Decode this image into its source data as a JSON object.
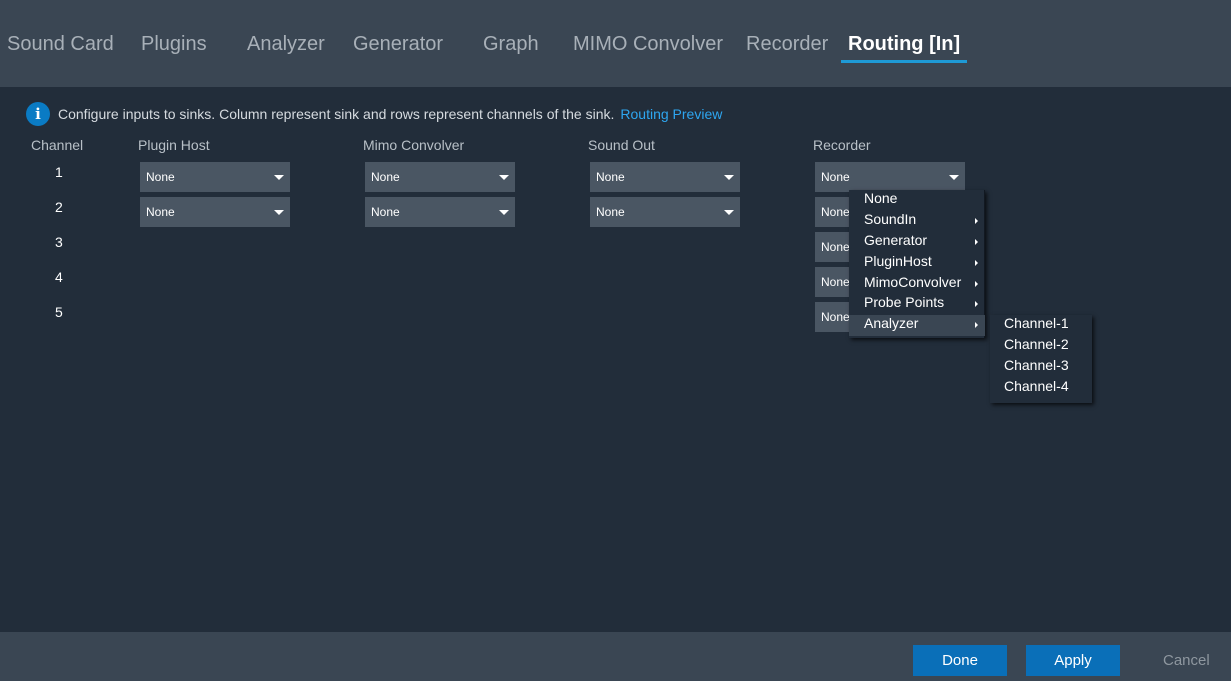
{
  "tabs": [
    {
      "label": "Sound Card"
    },
    {
      "label": "Plugins"
    },
    {
      "label": "Analyzer"
    },
    {
      "label": "Generator"
    },
    {
      "label": "Graph"
    },
    {
      "label": "MIMO Convolver"
    },
    {
      "label": "Recorder"
    },
    {
      "label": "Routing [In]",
      "active": true
    }
  ],
  "info": {
    "icon": "info-icon",
    "icon_glyph": "i",
    "text": "Configure inputs to sinks. Column represent sink and rows represent channels of the sink.",
    "link": "Routing Preview"
  },
  "grid": {
    "channel_header": "Channel",
    "sinks": [
      "Plugin Host",
      "Mimo Convolver",
      "Sound Out",
      "Recorder"
    ],
    "rows": [
      "1",
      "2",
      "3",
      "4",
      "5"
    ],
    "values": {
      "plugin_host": [
        "None",
        "None"
      ],
      "mimo_convolver": [
        "None",
        "None"
      ],
      "sound_out": [
        "None",
        "None"
      ],
      "recorder": [
        "None",
        "None",
        "None",
        "None",
        "None"
      ]
    }
  },
  "menu": {
    "items": [
      "None",
      "SoundIn",
      "Generator",
      "PluginHost",
      "MimoConvolver",
      "Probe Points",
      "Analyzer"
    ],
    "highlighted": "Analyzer"
  },
  "submenu": {
    "items": [
      "Channel-1",
      "Channel-2",
      "Channel-3",
      "Channel-4"
    ]
  },
  "footer": {
    "done": "Done",
    "apply": "Apply",
    "cancel": "Cancel"
  },
  "colors": {
    "accent": "#1e9ad6",
    "button": "#0a6fb8",
    "link": "#2ea6f0",
    "background": "#222d3a",
    "bar": "#3a4653"
  }
}
